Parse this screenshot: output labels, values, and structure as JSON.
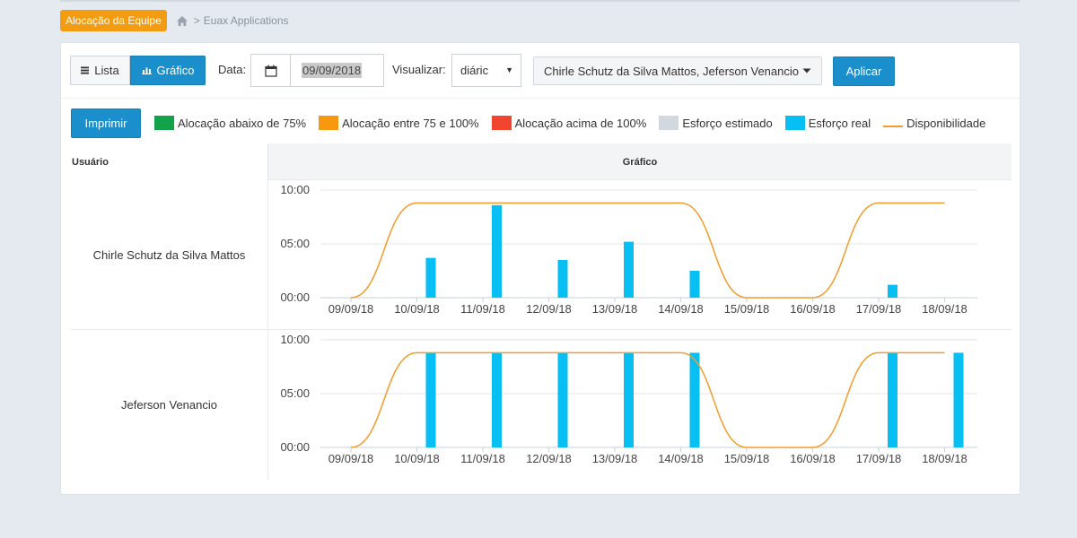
{
  "breadcrumb": {
    "badge": "Alocação da Equipe",
    "link": "Euax Applications",
    "separator": ">"
  },
  "toolbar": {
    "lista_label": "Lista",
    "grafico_label": "Gráfico",
    "data_label": "Data:",
    "date_value": "09/09/2018",
    "visualizar_label": "Visualizar:",
    "visualizar_value": "diáric",
    "users_label": "Chirle Schutz da Silva Mattos, Jeferson Venancio",
    "aplicar_label": "Aplicar"
  },
  "actions": {
    "imprimir_label": "Imprimir"
  },
  "legend": [
    {
      "label": "Alocação abaixo de 75%",
      "color": "#12a34a"
    },
    {
      "label": "Alocação entre 75 e 100%",
      "color": "#f8980f"
    },
    {
      "label": "Alocação acima de 100%",
      "color": "#f2452f"
    },
    {
      "label": "Esforço estimado",
      "color": "#d3d7de"
    },
    {
      "label": "Esforço real",
      "color": "#07bff2"
    },
    {
      "label": "Disponibilidade",
      "color": "#f39c2c"
    }
  ],
  "table": {
    "col_user": "Usuário",
    "col_chart": "Gráfico"
  },
  "chart_data": [
    {
      "type": "bar",
      "user": "Chirle Schutz da Silva Mattos",
      "categories": [
        "09/09/18",
        "10/09/18",
        "11/09/18",
        "12/09/18",
        "13/09/18",
        "14/09/18",
        "15/09/18",
        "16/09/18",
        "17/09/18",
        "18/09/18"
      ],
      "yticks": [
        "00:00",
        "05:00",
        "10:00"
      ],
      "ylim": [
        0,
        10
      ],
      "series": [
        {
          "name": "Esforço real",
          "type": "bar",
          "color": "#07bff2",
          "values": [
            0,
            3.7,
            8.6,
            3.5,
            5.2,
            2.5,
            0,
            0,
            1.2,
            0
          ]
        },
        {
          "name": "Disponibilidade",
          "type": "line",
          "color": "#f39c2c",
          "values": [
            0,
            8.8,
            8.8,
            8.8,
            8.8,
            8.8,
            0,
            0,
            8.8,
            8.8
          ]
        }
      ]
    },
    {
      "type": "bar",
      "user": "Jeferson Venancio",
      "categories": [
        "09/09/18",
        "10/09/18",
        "11/09/18",
        "12/09/18",
        "13/09/18",
        "14/09/18",
        "15/09/18",
        "16/09/18",
        "17/09/18",
        "18/09/18"
      ],
      "yticks": [
        "00:00",
        "05:00",
        "10:00"
      ],
      "ylim": [
        0,
        10
      ],
      "series": [
        {
          "name": "Esforço real",
          "type": "bar",
          "color": "#07bff2",
          "values": [
            0,
            8.8,
            8.8,
            8.8,
            8.8,
            8.8,
            0,
            0,
            8.8,
            8.8
          ]
        },
        {
          "name": "Disponibilidade",
          "type": "line",
          "color": "#f39c2c",
          "values": [
            0,
            8.8,
            8.8,
            8.8,
            8.8,
            8.8,
            0,
            0,
            8.8,
            8.8
          ]
        }
      ]
    }
  ]
}
